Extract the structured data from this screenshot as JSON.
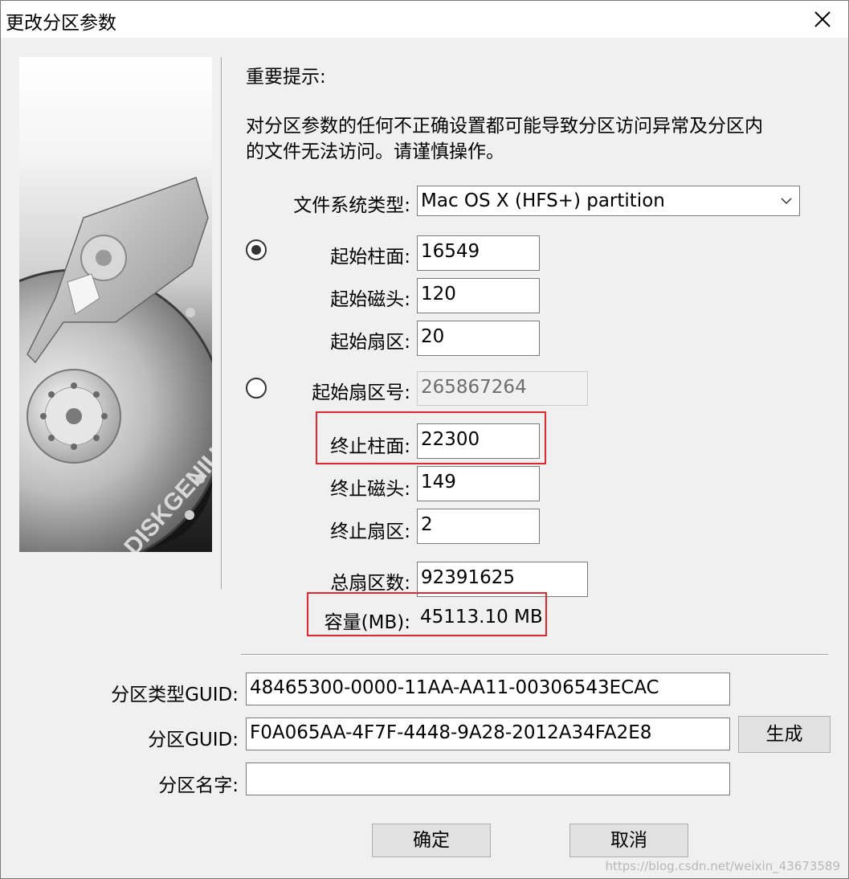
{
  "dialog": {
    "title": "更改分区参数"
  },
  "notice": {
    "heading": "重要提示:",
    "line1": "对分区参数的任何不正确设置都可能导致分区访问异常及分区内",
    "line2": "的文件无法访问。请谨慎操作。"
  },
  "fs_type": {
    "label": "文件系统类型:",
    "value": "Mac OS X (HFS+) partition"
  },
  "chs_mode": {
    "selected": true,
    "start_cylinder": {
      "label": "起始柱面:",
      "value": "16549"
    },
    "start_head": {
      "label": "起始磁头:",
      "value": "120"
    },
    "start_sector": {
      "label": "起始扇区:",
      "value": "20"
    }
  },
  "lba_mode": {
    "selected": false,
    "start_lba": {
      "label": "起始扇区号:",
      "value": "265867264"
    }
  },
  "end": {
    "cylinder": {
      "label": "终止柱面:",
      "value": "22300"
    },
    "head": {
      "label": "终止磁头:",
      "value": "149"
    },
    "sector": {
      "label": "终止扇区:",
      "value": "2"
    }
  },
  "totals": {
    "total_sectors": {
      "label": "总扇区数:",
      "value": "92391625"
    },
    "capacity": {
      "label": "容量(MB):",
      "value": "45113.10 MB"
    }
  },
  "guid": {
    "type_label": "分区类型GUID:",
    "type_value": "48465300-0000-11AA-AA11-00306543ECAC",
    "part_label": "分区GUID:",
    "part_value": "F0A065AA-4F7F-4448-9A28-2012A34FA2E8",
    "generate_button": "生成",
    "name_label": "分区名字:",
    "name_value": ""
  },
  "buttons": {
    "ok": "确定",
    "cancel": "取消"
  },
  "watermark": "https://blog.csdn.net/weixin_43673589",
  "side_image": {
    "brand_text": "DISKGENIUS"
  },
  "highlight_color": "#e0272e"
}
